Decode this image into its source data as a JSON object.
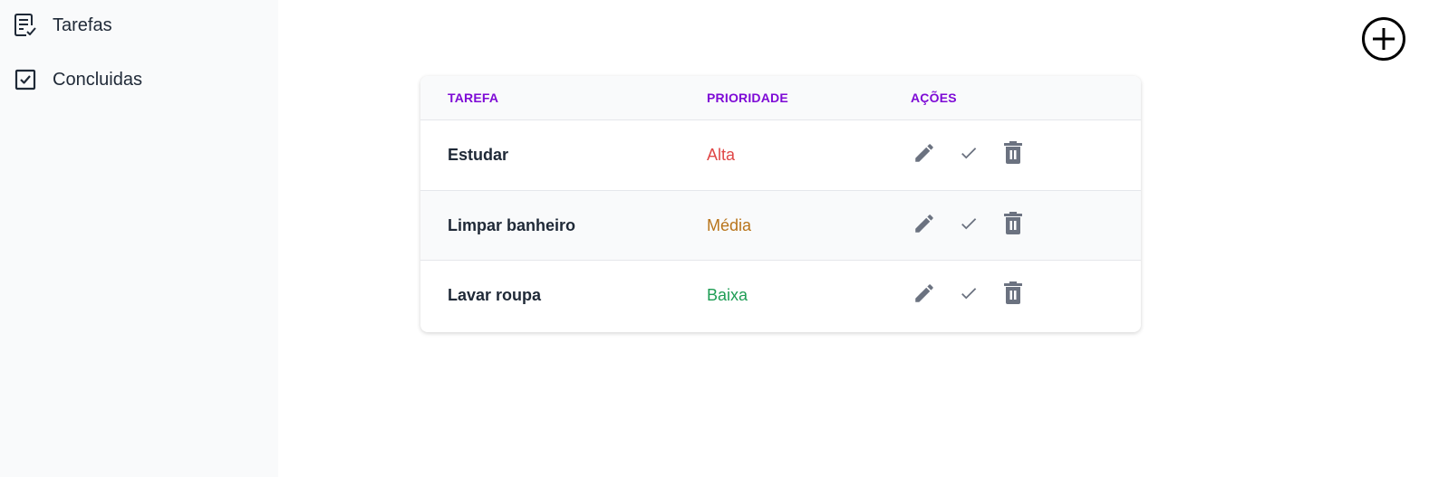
{
  "sidebar": {
    "items": [
      {
        "label": "Tarefas",
        "icon": "task-list-icon"
      },
      {
        "label": "Concluidas",
        "icon": "checkbox-icon"
      }
    ]
  },
  "toolbar": {
    "add_icon": "plus-circle-icon"
  },
  "table": {
    "headers": [
      "TAREFA",
      "PRIORIDADE",
      "AÇÕES"
    ],
    "rows": [
      {
        "task": "Estudar",
        "priority": "Alta",
        "priority_color": "#e04747"
      },
      {
        "task": "Limpar banheiro",
        "priority": "Média",
        "priority_color": "#b8741a"
      },
      {
        "task": "Lavar roupa",
        "priority": "Baixa",
        "priority_color": "#1f9d55"
      }
    ],
    "action_icons": [
      "pencil-icon",
      "check-icon",
      "trash-icon"
    ]
  },
  "colors": {
    "header_text": "#7e0ad6",
    "icon_gray": "#6b7280",
    "sidebar_bg": "#f9fafb"
  }
}
